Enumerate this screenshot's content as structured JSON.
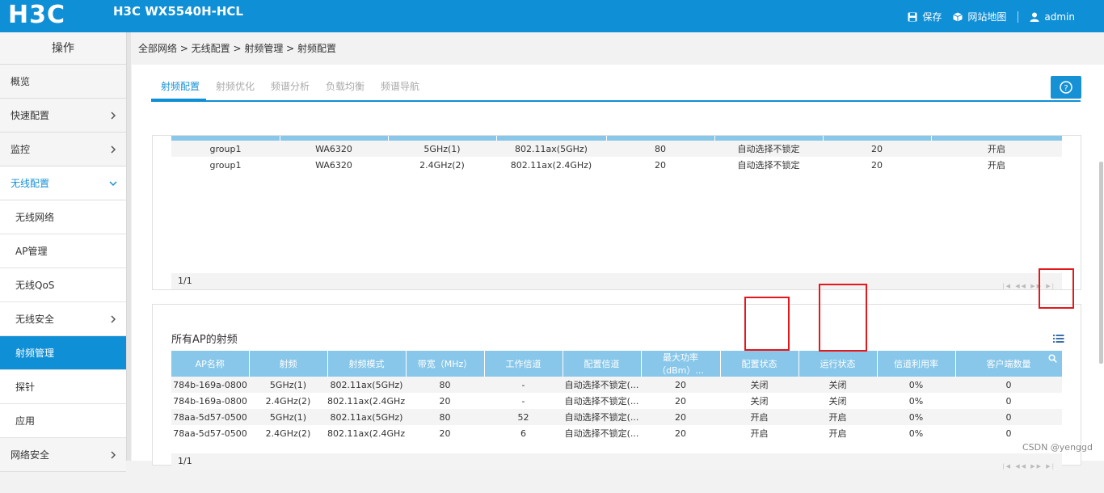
{
  "header": {
    "logo": "H3C",
    "device": "H3C WX5540H-HCL",
    "save": "保存",
    "sitemap": "网站地图",
    "user": "admin"
  },
  "sidebar": {
    "title": "操作",
    "items": [
      {
        "label": "概览"
      },
      {
        "label": "快速配置"
      },
      {
        "label": "监控"
      },
      {
        "label": "无线配置"
      },
      {
        "label": "无线网络"
      },
      {
        "label": "AP管理"
      },
      {
        "label": "无线QoS"
      },
      {
        "label": "无线安全"
      },
      {
        "label": "射频管理"
      },
      {
        "label": "探针"
      },
      {
        "label": "应用"
      },
      {
        "label": "网络安全"
      }
    ]
  },
  "breadcrumb": "全部网络 > 无线配置 > 射频管理 > 射频配置",
  "tabs": [
    "射频配置",
    "射频优化",
    "频谱分析",
    "负载均衡",
    "频谱导航"
  ],
  "group_table": {
    "rows": [
      [
        "group1",
        "WA6320",
        "5GHz(1)",
        "802.11ax(5GHz)",
        "80",
        "自动选择不锁定",
        "20",
        "开启"
      ],
      [
        "group1",
        "WA6320",
        "2.4GHz(2)",
        "802.11ax(2.4GHz)",
        "20",
        "自动选择不锁定",
        "20",
        "开启"
      ]
    ],
    "page": "1/1"
  },
  "ap_section": {
    "title": "所有AP的射频",
    "columns": [
      "AP名称",
      "射频",
      "射频模式",
      "带宽（MHz）",
      "工作信道",
      "配置信道",
      "最大功率（dBm）...",
      "配置状态",
      "运行状态",
      "信道利用率",
      "客户端数量"
    ],
    "rows": [
      [
        "784b-169a-0800",
        "5GHz(1)",
        "802.11ax(5GHz)",
        "80",
        "-",
        "自动选择不锁定(...",
        "20",
        "关闭",
        "关闭",
        "0%",
        "0"
      ],
      [
        "784b-169a-0800",
        "2.4GHz(2)",
        "802.11ax(2.4GHz)",
        "20",
        "-",
        "自动选择不锁定(...",
        "20",
        "关闭",
        "关闭",
        "0%",
        "0"
      ],
      [
        "78aa-5d57-0500",
        "5GHz(1)",
        "802.11ax(5GHz)",
        "80",
        "52",
        "自动选择不锁定(...",
        "20",
        "开启",
        "开启",
        "0%",
        "0"
      ],
      [
        "78aa-5d57-0500",
        "2.4GHz(2)",
        "802.11ax(2.4GHz)",
        "20",
        "6",
        "自动选择不锁定(...",
        "20",
        "开启",
        "开启",
        "0%",
        "0"
      ]
    ],
    "page": "1/1"
  },
  "watermark": "CSDN @yenggd",
  "colors": {
    "header_blue": "#0f8fd6",
    "table_header": "#88c7ea",
    "highlight_red": "#e5171b"
  }
}
